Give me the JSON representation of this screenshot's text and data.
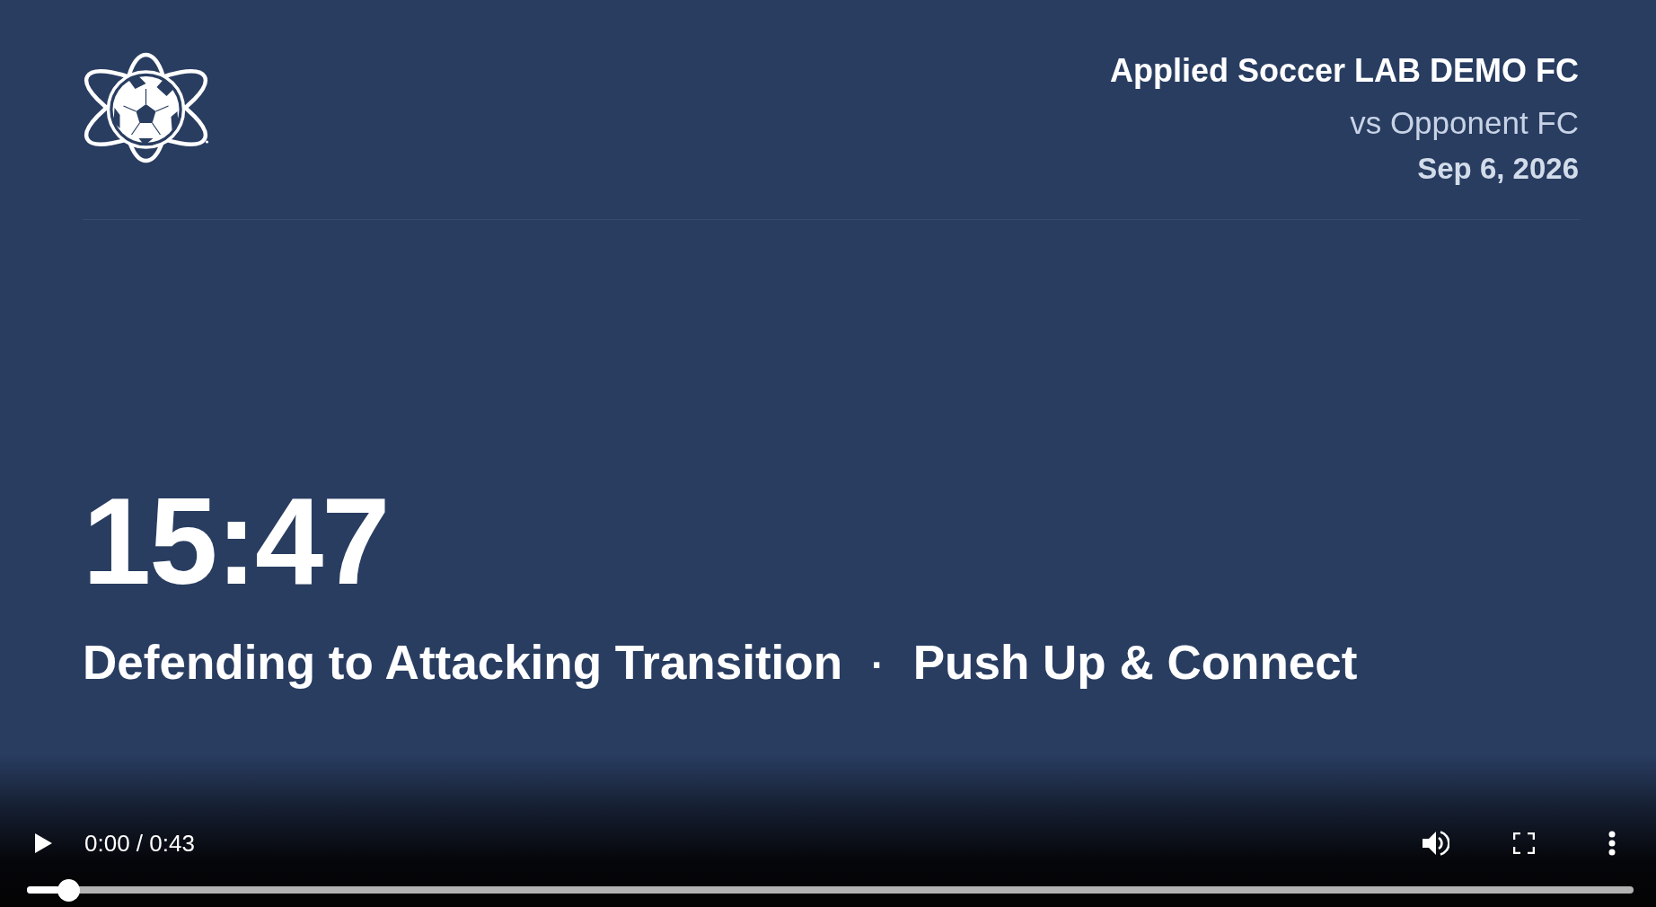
{
  "video_frame": {
    "team": "Applied Soccer LAB DEMO FC",
    "opponent": "vs Opponent FC",
    "date": "Sep 6, 2026",
    "clock": "15:47",
    "phase": "Defending to Attacking Transition",
    "separator": "·",
    "action": "Push Up & Connect"
  },
  "player_controls": {
    "playing": false,
    "muted": false,
    "time": "0:00 / 0:43",
    "progress": {
      "level": 0.02
    }
  }
}
